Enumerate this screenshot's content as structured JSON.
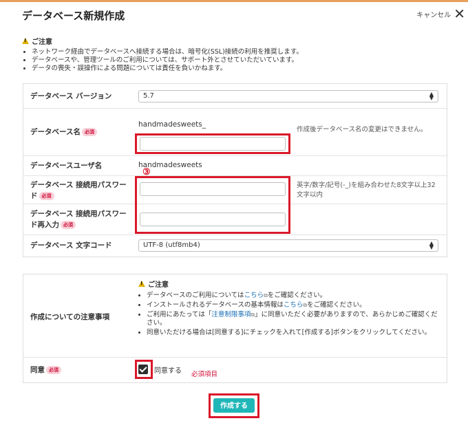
{
  "dialog": {
    "title": "データベース新規作成",
    "cancel_label": "キャンセル",
    "close_glyph": "✕"
  },
  "notice": {
    "heading": "ご注意",
    "items": [
      "ネットワーク経由でデータベースへ接続する場合は、暗号化(SSL)接続の利用を推奨します。",
      "データベースや、管理ツールのご利用については、サポート外とさせていただいています。",
      "データの喪失・誤操作による問題については責任を負いかねます。"
    ]
  },
  "form": {
    "required_badge": "必須",
    "version": {
      "label": "データベース バージョン",
      "value": "5.7"
    },
    "db_name": {
      "label": "データベース名",
      "prefix": "handmadesweets_",
      "value": "",
      "hint": "作成後データベース名の変更はできません。"
    },
    "db_user": {
      "label": "データベースユーザ名",
      "value": "handmadesweets"
    },
    "password": {
      "label": "データベース 接続用パスワード",
      "value": "",
      "hint": "英字/数字/記号(-_)を組み合わせた8文字以上32文字以内"
    },
    "password_confirm": {
      "label": "データベース 接続用パスワード再入力",
      "value": ""
    },
    "charset": {
      "label": "データベース 文字コード",
      "value": "UTF-8 (utf8mb4)"
    },
    "step_marker": "③"
  },
  "notes": {
    "label": "作成についての注意事項",
    "heading": "ご注意",
    "link_text": "こちら",
    "restriction_link": "注意制限事項",
    "item1_pre": "データベースのご利用については",
    "item1_post": "をご確認ください。",
    "item2_pre": "インストールされるデータベースの基本情報は",
    "item2_post": "をご確認ください。",
    "item3_pre": "ご利用にあたっては「",
    "item3_post": "」に同意いただく必要がありますので、あらかじめご確認ください。",
    "item4": "同意いただける場合は[同意する]にチェックを入れて[作成する]ボタンをクリックしてください。"
  },
  "agree": {
    "label": "同意",
    "checkbox_label": "同意する",
    "checked": true,
    "required_note": "必須項目"
  },
  "submit_label": "作成する",
  "colors": {
    "accent": "#1fb6b8",
    "highlight": "#d9182a",
    "required": "#d0103a"
  }
}
